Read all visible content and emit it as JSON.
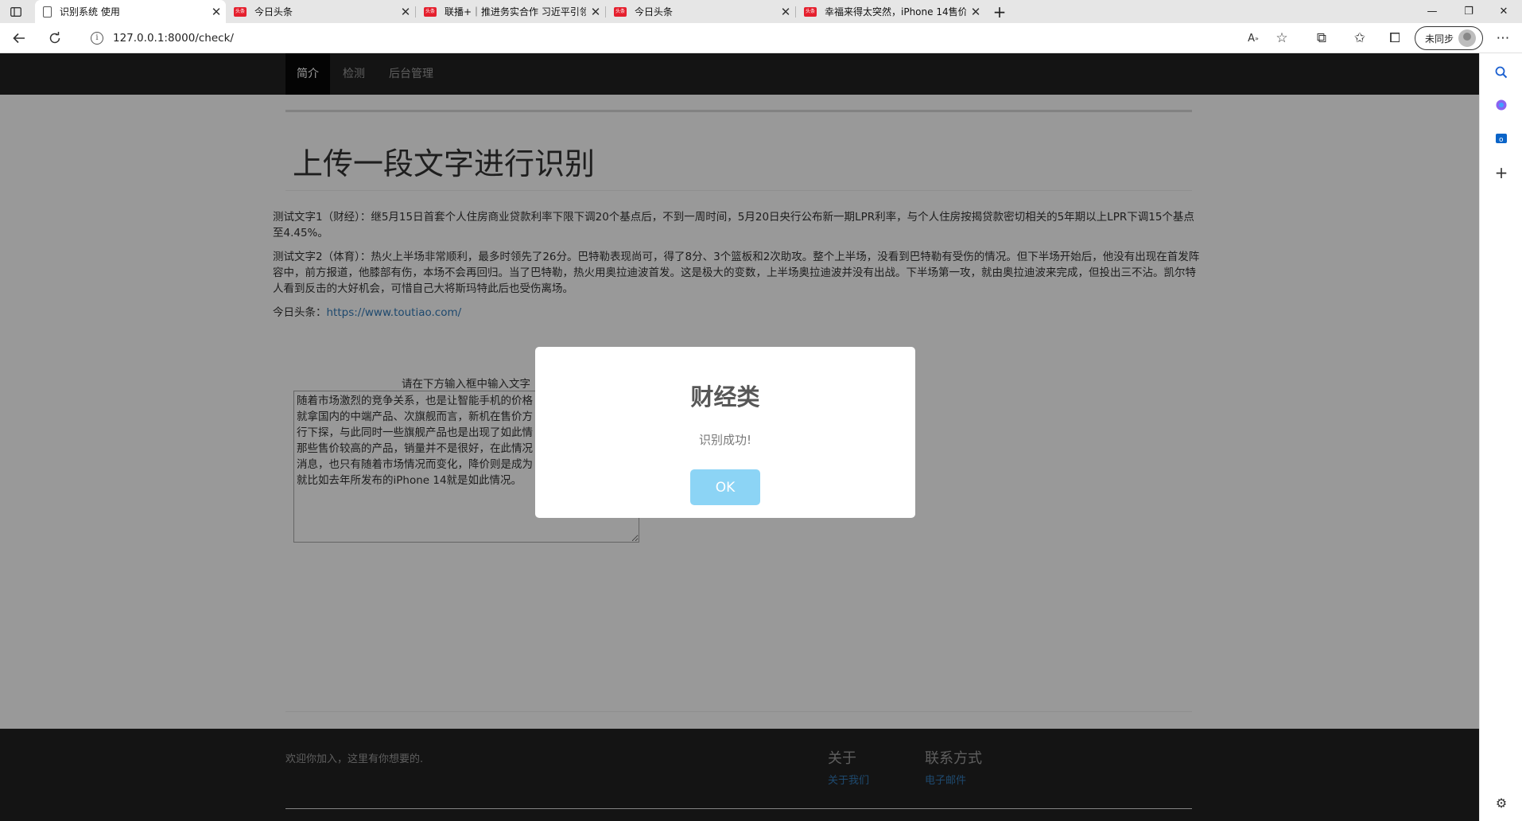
{
  "browser": {
    "tabs": [
      {
        "title": "识别系统 使用",
        "favicon": "page-icon",
        "active": true
      },
      {
        "title": "今日头条",
        "favicon": "toutiao-icon",
        "active": false
      },
      {
        "title": "联播+｜推进务实合作 习近平引领",
        "favicon": "toutiao-icon",
        "active": false
      },
      {
        "title": "今日头条",
        "favicon": "toutiao-icon",
        "active": false
      },
      {
        "title": "幸福来得太突然，iPhone 14售价",
        "favicon": "toutiao-icon",
        "active": false
      }
    ],
    "favicon_label": "头条",
    "new_tab": "+",
    "url": "127.0.0.1:8000/check/",
    "profile_label": "未同步"
  },
  "site": {
    "nav": [
      "简介",
      "检测",
      "后台管理"
    ],
    "page_title": "上传一段文字进行识别",
    "paragraphs": [
      "测试文字1（财经）：继5月15日首套个人住房商业贷款利率下限下调20个基点后，不到一周时间，5月20日央行公布新一期LPR利率，与个人住房按揭贷款密切相关的5年期以上LPR下调15个基点至4.45%。",
      "测试文字2（体育）：热火上半场非常顺利，最多时领先了26分。巴特勒表现尚可，得了8分、3个篮板和2次助攻。整个上半场，没看到巴特勒有受伤的情况。但下半场开始后，他没有出现在首发阵容中，前方报道，他膝部有伤，本场不会再回归。当了巴特勒，热火用奥拉迪波首发。这是极大的变数，上半场奥拉迪波并没有出战。下半场第一攻，就由奥拉迪波来完成，但投出三不沾。凯尔特人看到反击的大好机会，可惜自己大将斯玛特此后也受伤离场。"
    ],
    "link_label": "今日头条：",
    "link_url": "https://www.toutiao.com/",
    "form_label": "请在下方输入框中输入文字",
    "textarea_value": "随着市场激烈的竞争关系，也是让智能手机的价格\n就拿国内的中端产品、次旗舰而言，新机在售价方\n行下探，与此同时一些旗舰产品也是出现了如此情\n那些售价较高的产品，销量并不是很好，在此情况\n消息，也只有随着市场情况而变化，降价则是成为\n就比如去年所发布的iPhone 14就是如此情况。",
    "footer": {
      "welcome": "欢迎你加入，这里有你想要的.",
      "about_title": "关于",
      "about_link": "关于我们",
      "contact_title": "联系方式",
      "contact_link": "电子邮件"
    }
  },
  "modal": {
    "title": "财经类",
    "text": "识别成功!",
    "ok_label": "OK"
  },
  "colors": {
    "navbar": "#222222",
    "link": "#337ab7",
    "ok_button": "#8cd4f5",
    "favicon_red": "#e5202e"
  }
}
